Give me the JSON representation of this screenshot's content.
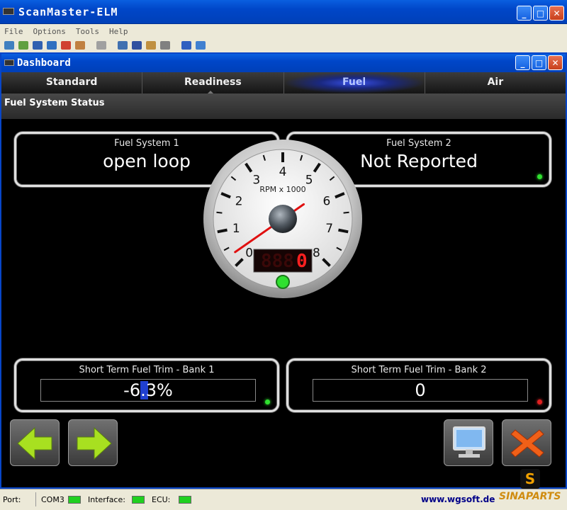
{
  "app": {
    "title": "ScanMaster-ELM",
    "menu": [
      "File",
      "Options",
      "Tools",
      "Help"
    ],
    "window_buttons": {
      "minimize": "_",
      "maximize": "□",
      "close": "✕"
    }
  },
  "dashboard": {
    "title": "Dashboard",
    "tabs": [
      {
        "label": "Standard",
        "active": false
      },
      {
        "label": "Readiness",
        "active": false
      },
      {
        "label": "Fuel",
        "active": true
      },
      {
        "label": "Air",
        "active": false
      }
    ],
    "section_title": "Fuel System Status",
    "fuel_system_1": {
      "label": "Fuel System 1",
      "value": "open loop",
      "status": "green"
    },
    "fuel_system_2": {
      "label": "Fuel System 2",
      "value": "Not Reported",
      "status": "green"
    },
    "tachometer": {
      "label": "RPM x 1000",
      "ticks": [
        "0",
        "1",
        "2",
        "3",
        "4",
        "5",
        "6",
        "7",
        "8"
      ],
      "value": 0.3,
      "digital_readout": "0",
      "digital_placeholder": "888"
    },
    "stft_bank_1": {
      "label": "Short Term Fuel Trim - Bank 1",
      "value": "-6.3%",
      "percent": -6.3,
      "status": "green"
    },
    "stft_bank_2": {
      "label": "Short Term Fuel Trim - Bank 2",
      "value": "0",
      "percent": 0,
      "status": "red"
    }
  },
  "statusbar": {
    "port_label": "Port:",
    "port_value": "COM3",
    "interface_label": "Interface:",
    "ecu_label": "ECU:",
    "website": "www.wgsoft.de"
  },
  "watermark": {
    "text": "SINAPARTS",
    "logo_letter": "S"
  },
  "colors": {
    "accent_blue": "#0046c8",
    "led_green": "#20d020",
    "nav_arrow": "#a8e020",
    "close_orange": "#f06018"
  }
}
